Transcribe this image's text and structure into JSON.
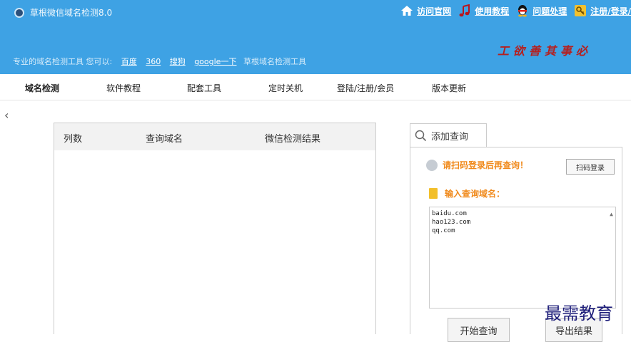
{
  "window": {
    "title": "草根微信域名检测8.0"
  },
  "top_links": [
    {
      "label": "访问官网",
      "icon": "home-icon"
    },
    {
      "label": "使用教程",
      "icon": "music-note-icon"
    },
    {
      "label": "问题处理",
      "icon": "qq-penguin-icon"
    },
    {
      "label": "注册/登录/",
      "icon": "key-icon"
    }
  ],
  "slogan": {
    "intro": "专业的域名检测工具  您可以:",
    "links": [
      "百度",
      "360",
      "搜狗",
      "google一下"
    ],
    "tail": "草根域名检测工具"
  },
  "art_text": "工欲善其事必",
  "tabs": [
    "域名检测",
    "软件教程",
    "配套工具",
    "定时关机",
    "登陆/注册/会员",
    "版本更新"
  ],
  "back_glyph": "‹",
  "table": {
    "columns": [
      "列数",
      "查询域名",
      "微信检测结果"
    ]
  },
  "add_query": {
    "label": "添加查询"
  },
  "login_prompt": "请扫码登录后再查询！",
  "scan_login_button": "扫码登录",
  "enter_label": "输入查询域名：",
  "domains": [
    "baidu.com",
    "hao123.com",
    "qq.com"
  ],
  "buttons": {
    "start": "开始查询",
    "export": "导出结果"
  },
  "watermark": "最需教育",
  "colors": {
    "titlebar": "#3ea2e4",
    "accent_orange": "#f08a1c"
  }
}
